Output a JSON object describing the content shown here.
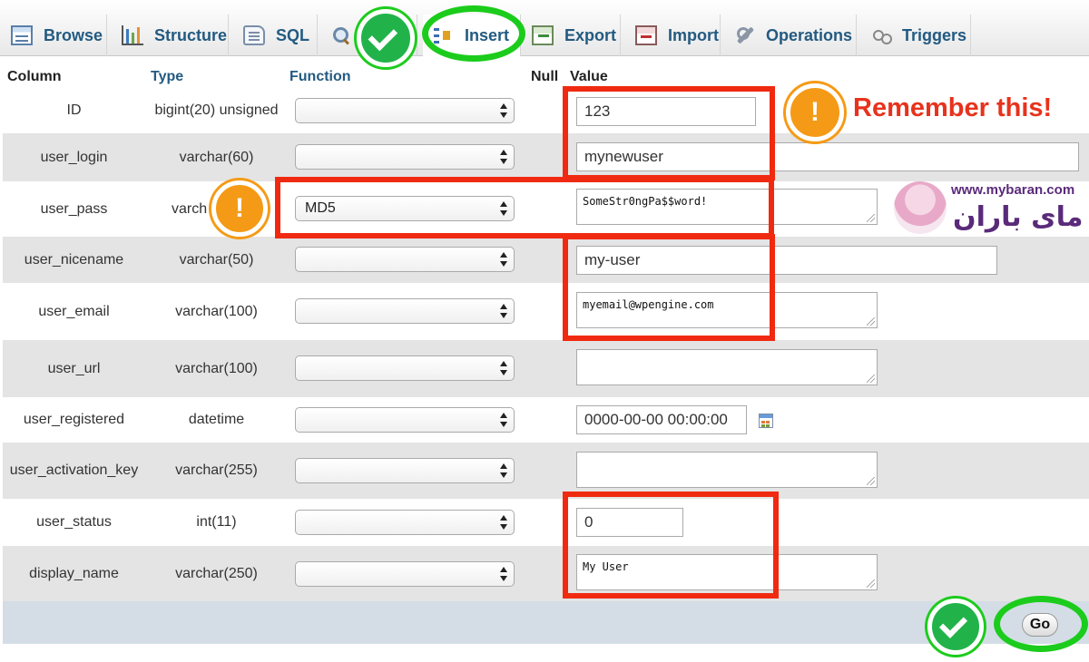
{
  "tabs": [
    {
      "label": "Browse",
      "icon": "table-icon"
    },
    {
      "label": "Structure",
      "icon": "structure-icon"
    },
    {
      "label": "SQL",
      "icon": "sql-icon"
    },
    {
      "label": "",
      "icon": "search-icon"
    },
    {
      "label": "Insert",
      "icon": "insert-icon"
    },
    {
      "label": "Export",
      "icon": "export-icon"
    },
    {
      "label": "Import",
      "icon": "import-icon"
    },
    {
      "label": "Operations",
      "icon": "operations-icon"
    },
    {
      "label": "Triggers",
      "icon": "triggers-icon"
    }
  ],
  "active_tab": "Insert",
  "headers": {
    "column": "Column",
    "type": "Type",
    "function": "Function",
    "null": "Null",
    "value": "Value"
  },
  "rows": [
    {
      "column": "ID",
      "type": "bigint(20) unsigned",
      "function": "",
      "value": "123"
    },
    {
      "column": "user_login",
      "type": "varchar(60)",
      "function": "",
      "value": "mynewuser"
    },
    {
      "column": "user_pass",
      "type": "varch",
      "function": "MD5",
      "value": "SomeStr0ngPa$$word!"
    },
    {
      "column": "user_nicename",
      "type": "varchar(50)",
      "function": "",
      "value": "my-user"
    },
    {
      "column": "user_email",
      "type": "varchar(100)",
      "function": "",
      "value": "myemail@wpengine.com"
    },
    {
      "column": "user_url",
      "type": "varchar(100)",
      "function": "",
      "value": ""
    },
    {
      "column": "user_registered",
      "type": "datetime",
      "function": "",
      "value": "0000-00-00 00:00:00"
    },
    {
      "column": "user_activation_key",
      "type": "varchar(255)",
      "function": "",
      "value": ""
    },
    {
      "column": "user_status",
      "type": "int(11)",
      "function": "",
      "value": "0"
    },
    {
      "column": "display_name",
      "type": "varchar(250)",
      "function": "",
      "value": "My User"
    }
  ],
  "go_label": "Go",
  "annotation": {
    "remember": "Remember this!",
    "warn_symbol": "!"
  },
  "watermark": {
    "url": "www.mybaran.com",
    "name": "مای باران"
  },
  "colors": {
    "link": "#235a81",
    "annotation_red": "#f02a10",
    "annotation_green": "#1ccc1c",
    "warn_orange": "#f59a16",
    "footer": "#d4dde6"
  }
}
